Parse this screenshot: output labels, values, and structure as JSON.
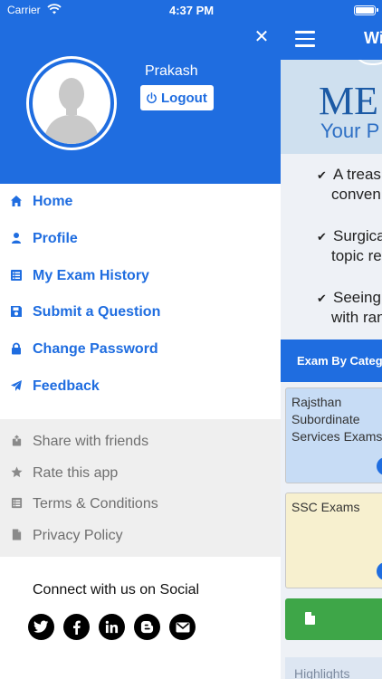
{
  "status_bar": {
    "carrier": "Carrier",
    "time": "4:37 PM"
  },
  "drawer": {
    "user_name": "Prakash",
    "logout_label": "Logout",
    "menu": [
      {
        "label": "Home",
        "icon": "home-icon"
      },
      {
        "label": "Profile",
        "icon": "person-icon"
      },
      {
        "label": "My Exam History",
        "icon": "list-icon"
      },
      {
        "label": "Submit a Question",
        "icon": "save-icon"
      },
      {
        "label": "Change Password",
        "icon": "lock-icon"
      },
      {
        "label": "Feedback",
        "icon": "send-icon"
      }
    ],
    "secondary_menu": [
      {
        "label": "Share with friends",
        "icon": "share-icon"
      },
      {
        "label": "Rate this app",
        "icon": "star-icon"
      },
      {
        "label": "Terms & Conditions",
        "icon": "list-icon"
      },
      {
        "label": "Privacy Policy",
        "icon": "document-icon"
      }
    ],
    "social_title": "Connect with us on Social",
    "social": [
      "twitter-icon",
      "facebook-icon",
      "linkedin-icon",
      "blogger-icon",
      "email-icon"
    ]
  },
  "app": {
    "title": "Wi",
    "banner_big": "ME",
    "banner_small": "Your P",
    "bullets": [
      {
        "line1": "A treas",
        "line2": "conveni"
      },
      {
        "line1": "Surgica",
        "line2": "topic re"
      },
      {
        "line1": "Seeing",
        "line2": "with ran"
      }
    ],
    "category_header": "Exam By Categ",
    "categories": [
      {
        "lines": [
          "Rajsthan",
          "Subordinate",
          "Services Exams"
        ]
      },
      {
        "lines": [
          "SSC Exams"
        ]
      }
    ],
    "highlights_label": "Highlights"
  },
  "colors": {
    "primary": "#1f6de0",
    "secondary_bg": "#efefef",
    "green_button": "#3ea648"
  }
}
